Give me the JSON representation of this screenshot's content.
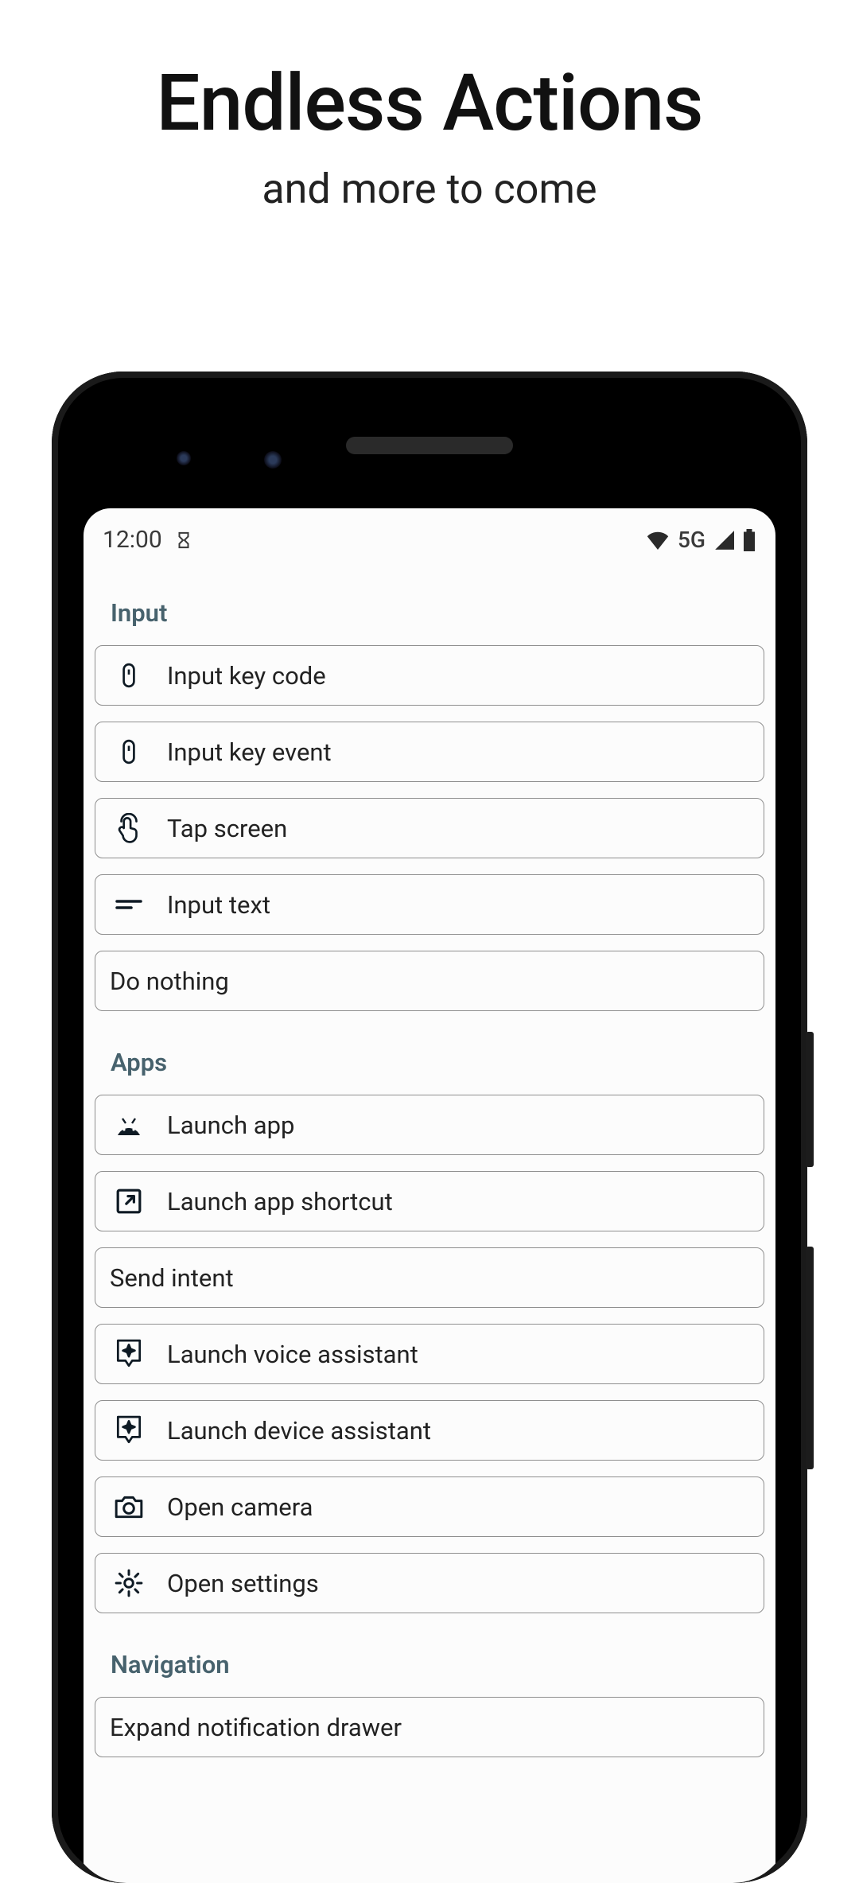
{
  "hero": {
    "title": "Endless Actions",
    "subtitle": "and more to come"
  },
  "statusbar": {
    "time": "12:00",
    "network": "5G"
  },
  "sections": {
    "input": {
      "header": "Input",
      "items": [
        {
          "label": "Input key code",
          "icon": "key"
        },
        {
          "label": "Input key event",
          "icon": "key"
        },
        {
          "label": "Tap screen",
          "icon": "touch"
        },
        {
          "label": "Input text",
          "icon": "lines"
        },
        {
          "label": "Do nothing",
          "icon": null
        }
      ]
    },
    "apps": {
      "header": "Apps",
      "items": [
        {
          "label": "Launch app",
          "icon": "android"
        },
        {
          "label": "Launch app shortcut",
          "icon": "openext"
        },
        {
          "label": "Send intent",
          "icon": null
        },
        {
          "label": "Launch voice assistant",
          "icon": "assistant"
        },
        {
          "label": "Launch device assistant",
          "icon": "assistant"
        },
        {
          "label": "Open camera",
          "icon": "camera"
        },
        {
          "label": "Open settings",
          "icon": "gear"
        }
      ]
    },
    "navigation": {
      "header": "Navigation",
      "items": [
        {
          "label": "Expand notification drawer",
          "icon": null
        }
      ]
    }
  }
}
